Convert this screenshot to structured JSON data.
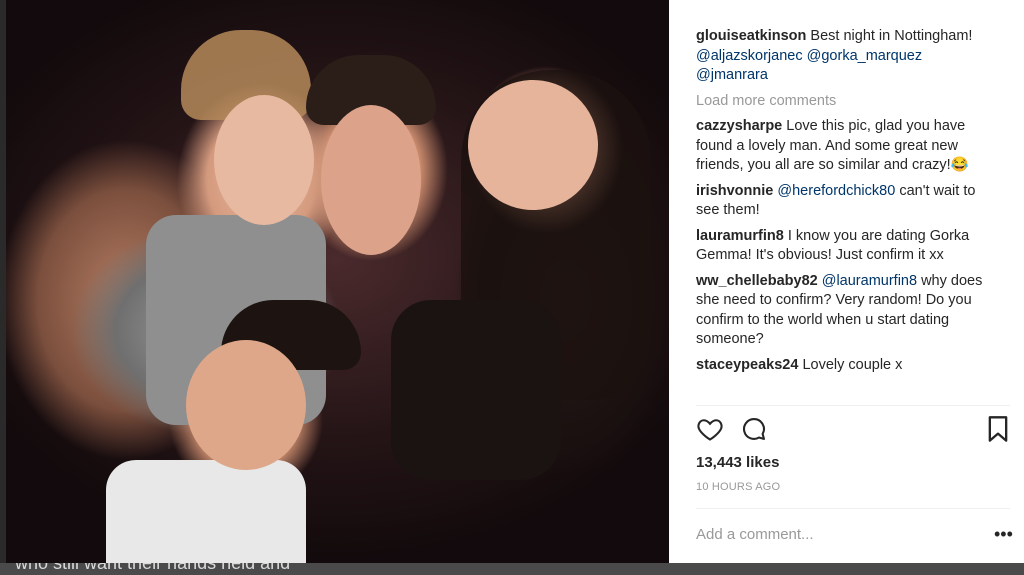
{
  "photo": {
    "caption_fragment": "who still want their hands held and"
  },
  "post": {
    "caption": {
      "username": "glouiseatkinson",
      "text": "Best night in Nottingham!",
      "mentions": [
        "@aljazskorjanec",
        "@gorka_marquez",
        "@jmanrara"
      ]
    },
    "load_more": "Load more comments",
    "comments": [
      {
        "username": "cazzysharpe",
        "pre": "Love this pic, glad you have found a lovely man. And some great new friends, you all are so similar and crazy!😂",
        "mention": "",
        "post": ""
      },
      {
        "username": "irishvonnie",
        "pre": "",
        "mention": "@herefordchick80",
        "post": "can't wait to see them!"
      },
      {
        "username": "lauramurfin8",
        "pre": "I know you are dating Gorka Gemma! It's obvious! Just confirm it xx",
        "mention": "",
        "post": ""
      },
      {
        "username": "ww_chellebaby82",
        "pre": "",
        "mention": "@lauramurfin8",
        "post": "why does she need to confirm? Very random! Do you confirm to the world when u start dating someone?"
      },
      {
        "username": "staceypeaks24",
        "pre": "Lovely couple x",
        "mention": "",
        "post": ""
      }
    ],
    "icons": [
      "heart-icon",
      "comment-icon",
      "bookmark-icon",
      "more-icon"
    ],
    "likes": "13,443 likes",
    "timestamp": "10 HOURS AGO",
    "add_comment_placeholder": "Add a comment...",
    "more_glyph": "•••"
  }
}
